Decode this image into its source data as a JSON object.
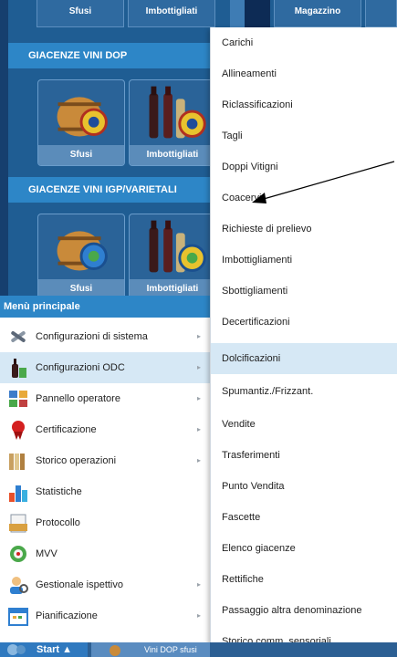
{
  "desktop": {
    "top_tiles": {
      "sfusi": "Sfusi",
      "imbottigliati": "Imbottigliati",
      "magazzino": "Magazzino"
    },
    "section_dop": "GIACENZE VINI DOP",
    "section_igp": "GIACENZE VINI IGP/VARIETALI",
    "tiles_dop": [
      {
        "label": "Sfusi"
      },
      {
        "label": "Imbottigliati"
      }
    ],
    "tiles_igp": [
      {
        "label": "Sfusi"
      },
      {
        "label": "Imbottigliati"
      }
    ]
  },
  "start_menu": {
    "title": "Menù principale",
    "items": [
      {
        "label": "Configurazioni di sistema",
        "icon": "wrench-tools-icon",
        "has_submenu": true
      },
      {
        "label": "Configurazioni ODC",
        "icon": "wine-bottle-icon",
        "has_submenu": true
      },
      {
        "label": "Pannello operatore",
        "icon": "panel-grid-icon",
        "has_submenu": true
      },
      {
        "label": "Certificazione",
        "icon": "certificate-ribbon-icon",
        "has_submenu": true
      },
      {
        "label": "Storico operazioni",
        "icon": "books-icon",
        "has_submenu": true
      },
      {
        "label": "Statistiche",
        "icon": "bar-chart-icon",
        "has_submenu": false
      },
      {
        "label": "Protocollo",
        "icon": "document-icon",
        "has_submenu": false
      },
      {
        "label": "MVV",
        "icon": "emblem-icon",
        "has_submenu": false
      },
      {
        "label": "Gestionale ispettivo",
        "icon": "inspector-icon",
        "has_submenu": true
      },
      {
        "label": "Pianificazione",
        "icon": "calendar-icon",
        "has_submenu": true
      }
    ],
    "arrow_glyph": "▸"
  },
  "submenu": {
    "items": [
      {
        "label": "Carichi"
      },
      {
        "label": "Allineamenti"
      },
      {
        "label": "Riclassificazioni"
      },
      {
        "label": "Tagli"
      },
      {
        "label": "Doppi Vitigni"
      },
      {
        "label": "Coacervi"
      },
      {
        "label": "Richieste di prelievo"
      },
      {
        "label": "Imbottigliamenti"
      },
      {
        "label": "Sbottigliamenti"
      },
      {
        "label": "Decertificazioni"
      },
      {
        "label": "Dolcificazioni"
      },
      {
        "label": "Spumantiz./Frizzant."
      },
      {
        "label": "Vendite"
      },
      {
        "label": "Trasferimenti"
      },
      {
        "label": "Punto Vendita"
      },
      {
        "label": "Fascette"
      },
      {
        "label": "Elenco giacenze"
      },
      {
        "label": "Rettifiche"
      },
      {
        "label": "Passaggio altra denominazione"
      },
      {
        "label": "Storico comm. sensoriali"
      }
    ]
  },
  "taskbar": {
    "start_label": "Start ▲",
    "task_label": "Vini DOP sfusi"
  },
  "colors": {
    "desktop_blue": "#1f5d93",
    "header_blue": "#2d86c7",
    "highlight": "#d6e8f5"
  }
}
